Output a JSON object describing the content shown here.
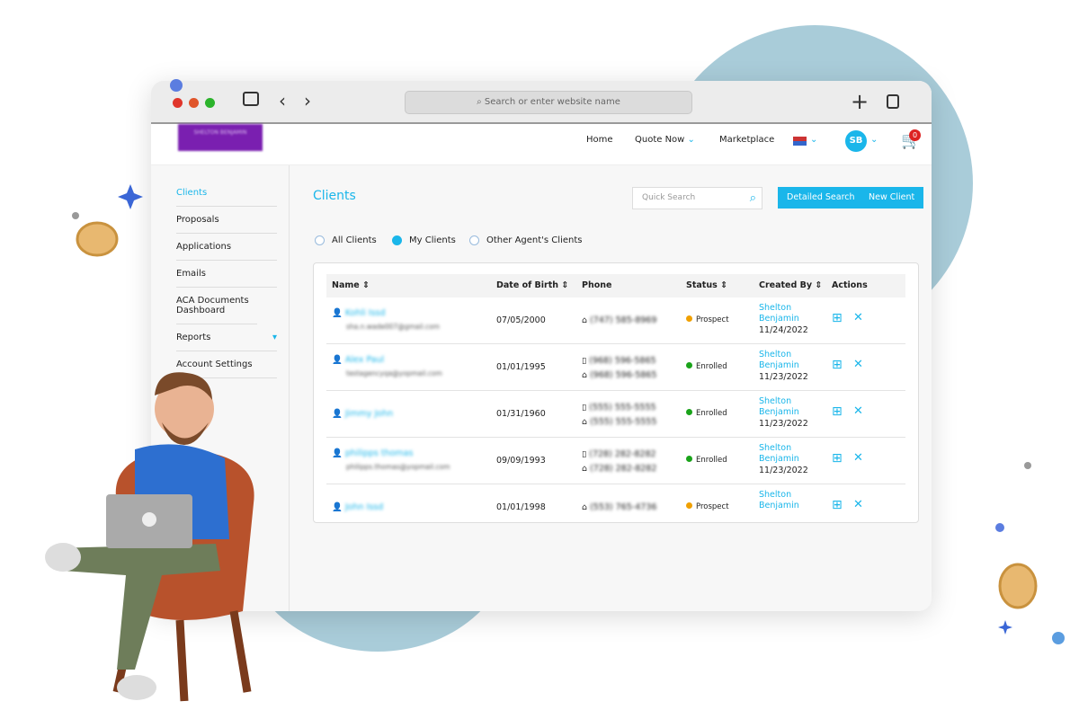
{
  "browser": {
    "address_placeholder": "Search or enter website name"
  },
  "nav": {
    "logo": "SHELTON BENJAMIN",
    "home": "Home",
    "quote": "Quote Now",
    "marketplace": "Marketplace",
    "avatar": "SB",
    "cart_count": "0"
  },
  "sidebar": {
    "items": [
      {
        "label": "Clients",
        "active": true
      },
      {
        "label": "Proposals"
      },
      {
        "label": "Applications"
      },
      {
        "label": "Emails"
      },
      {
        "label": "ACA Documents Dashboard"
      },
      {
        "label": "Reports"
      },
      {
        "label": "Account Settings"
      }
    ]
  },
  "main": {
    "title": "Clients",
    "search_placeholder": "Quick Search",
    "detailed": "Detailed Search",
    "new_client": "New Client",
    "filters": [
      {
        "label": "All Clients",
        "on": false
      },
      {
        "label": "My Clients",
        "on": true
      },
      {
        "label": "Other Agent's Clients",
        "on": false
      }
    ],
    "headers": [
      "Name",
      "Date of Birth",
      "Phone",
      "Status",
      "Created By",
      "Actions"
    ],
    "rows": [
      {
        "name": "Kohli Issd",
        "email": "sha.n.wade007@gmail.com",
        "dob": "07/05/2000",
        "phones": [
          "(747) 585-8969"
        ],
        "status": "Prospect",
        "creator": "Shelton Benjamin",
        "created": "11/24/2022"
      },
      {
        "name": "Alex Paul",
        "email": "testagencyqa@yopmail.com",
        "dob": "01/01/1995",
        "phones": [
          "(968) 596-5865",
          "(968) 596-5865"
        ],
        "status": "Enrolled",
        "creator": "Shelton Benjamin",
        "created": "11/23/2022"
      },
      {
        "name": "Jimmy John",
        "email": "",
        "dob": "01/31/1960",
        "phones": [
          "(555) 555-5555",
          "(555) 555-5555"
        ],
        "status": "Enrolled",
        "creator": "Shelton Benjamin",
        "created": "11/23/2022"
      },
      {
        "name": "philipps thomas",
        "email": "philipps.thomas@yopmail.com",
        "dob": "09/09/1993",
        "phones": [
          "(728) 282-8282",
          "(728) 282-8282"
        ],
        "status": "Enrolled",
        "creator": "Shelton Benjamin",
        "created": "11/23/2022"
      },
      {
        "name": "John Issd",
        "email": "",
        "dob": "01/01/1998",
        "phones": [
          "(553) 765-4736"
        ],
        "status": "Prospect",
        "creator": "Shelton Benjamin",
        "created": ""
      }
    ]
  },
  "colors": {
    "accent": "#1ab6ea",
    "prospect": "#f0a000",
    "enrolled": "#1aa31a"
  }
}
